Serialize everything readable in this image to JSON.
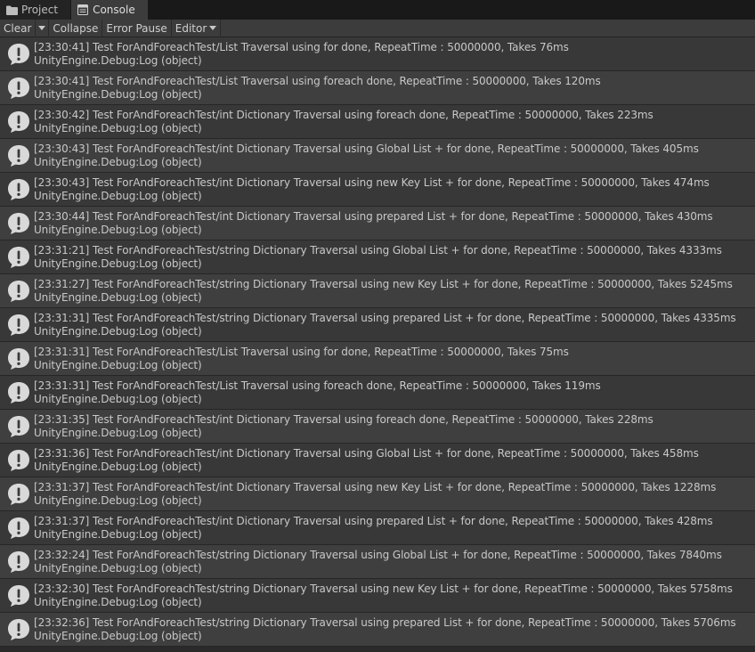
{
  "tabs": [
    {
      "label": "Project",
      "icon": "folder-icon"
    },
    {
      "label": "Console",
      "icon": "console-icon"
    }
  ],
  "toolbar": {
    "clear": "Clear",
    "collapse": "Collapse",
    "error_pause": "Error Pause",
    "editor": "Editor"
  },
  "logs": [
    {
      "line1": "[23:30:41] Test ForAndForeachTest/List Traversal using for done, RepeatTime : 50000000, Takes 76ms",
      "line2": "UnityEngine.Debug:Log (object)"
    },
    {
      "line1": "[23:30:41] Test ForAndForeachTest/List Traversal using foreach done, RepeatTime : 50000000, Takes 120ms",
      "line2": "UnityEngine.Debug:Log (object)"
    },
    {
      "line1": "[23:30:42] Test ForAndForeachTest/int Dictionary Traversal using foreach done, RepeatTime : 50000000, Takes 223ms",
      "line2": "UnityEngine.Debug:Log (object)"
    },
    {
      "line1": "[23:30:43] Test ForAndForeachTest/int Dictionary Traversal using Global List + for done, RepeatTime : 50000000, Takes 405ms",
      "line2": "UnityEngine.Debug:Log (object)"
    },
    {
      "line1": "[23:30:43] Test ForAndForeachTest/int Dictionary Traversal using new Key List + for done, RepeatTime : 50000000, Takes 474ms",
      "line2": "UnityEngine.Debug:Log (object)"
    },
    {
      "line1": "[23:30:44] Test ForAndForeachTest/int Dictionary Traversal using prepared List + for done, RepeatTime : 50000000, Takes 430ms",
      "line2": "UnityEngine.Debug:Log (object)"
    },
    {
      "line1": "[23:31:21] Test ForAndForeachTest/string Dictionary Traversal using Global List + for done, RepeatTime : 50000000, Takes 4333ms",
      "line2": "UnityEngine.Debug:Log (object)"
    },
    {
      "line1": "[23:31:27] Test ForAndForeachTest/string Dictionary Traversal using new Key List + for done, RepeatTime : 50000000, Takes 5245ms",
      "line2": "UnityEngine.Debug:Log (object)"
    },
    {
      "line1": "[23:31:31] Test ForAndForeachTest/string Dictionary Traversal using prepared List + for done, RepeatTime : 50000000, Takes 4335ms",
      "line2": "UnityEngine.Debug:Log (object)"
    },
    {
      "line1": "[23:31:31] Test ForAndForeachTest/List Traversal using for done, RepeatTime : 50000000, Takes 75ms",
      "line2": "UnityEngine.Debug:Log (object)"
    },
    {
      "line1": "[23:31:31] Test ForAndForeachTest/List Traversal using foreach done, RepeatTime : 50000000, Takes 119ms",
      "line2": "UnityEngine.Debug:Log (object)"
    },
    {
      "line1": "[23:31:35] Test ForAndForeachTest/int Dictionary Traversal using foreach done, RepeatTime : 50000000, Takes 228ms",
      "line2": "UnityEngine.Debug:Log (object)"
    },
    {
      "line1": "[23:31:36] Test ForAndForeachTest/int Dictionary Traversal using Global List + for done, RepeatTime : 50000000, Takes 458ms",
      "line2": "UnityEngine.Debug:Log (object)"
    },
    {
      "line1": "[23:31:37] Test ForAndForeachTest/int Dictionary Traversal using new Key List + for done, RepeatTime : 50000000, Takes 1228ms",
      "line2": "UnityEngine.Debug:Log (object)"
    },
    {
      "line1": "[23:31:37] Test ForAndForeachTest/int Dictionary Traversal using prepared List + for done, RepeatTime : 50000000, Takes 428ms",
      "line2": "UnityEngine.Debug:Log (object)"
    },
    {
      "line1": "[23:32:24] Test ForAndForeachTest/string Dictionary Traversal using Global List + for done, RepeatTime : 50000000, Takes 7840ms",
      "line2": "UnityEngine.Debug:Log (object)"
    },
    {
      "line1": "[23:32:30] Test ForAndForeachTest/string Dictionary Traversal using new Key List + for done, RepeatTime : 50000000, Takes 5758ms",
      "line2": "UnityEngine.Debug:Log (object)"
    },
    {
      "line1": "[23:32:36] Test ForAndForeachTest/string Dictionary Traversal using prepared List + for done, RepeatTime : 50000000, Takes 5706ms",
      "line2": "UnityEngine.Debug:Log (object)"
    }
  ],
  "log_icon": "info-bubble-icon",
  "colors": {
    "panel_bg": "#2a2a2a",
    "row_even": "#383838",
    "row_odd": "#3f3f3f",
    "toolbar": "#3c3c3c",
    "tab_active": "#3c3c3c",
    "icon_fill": "#d9d9d9"
  }
}
